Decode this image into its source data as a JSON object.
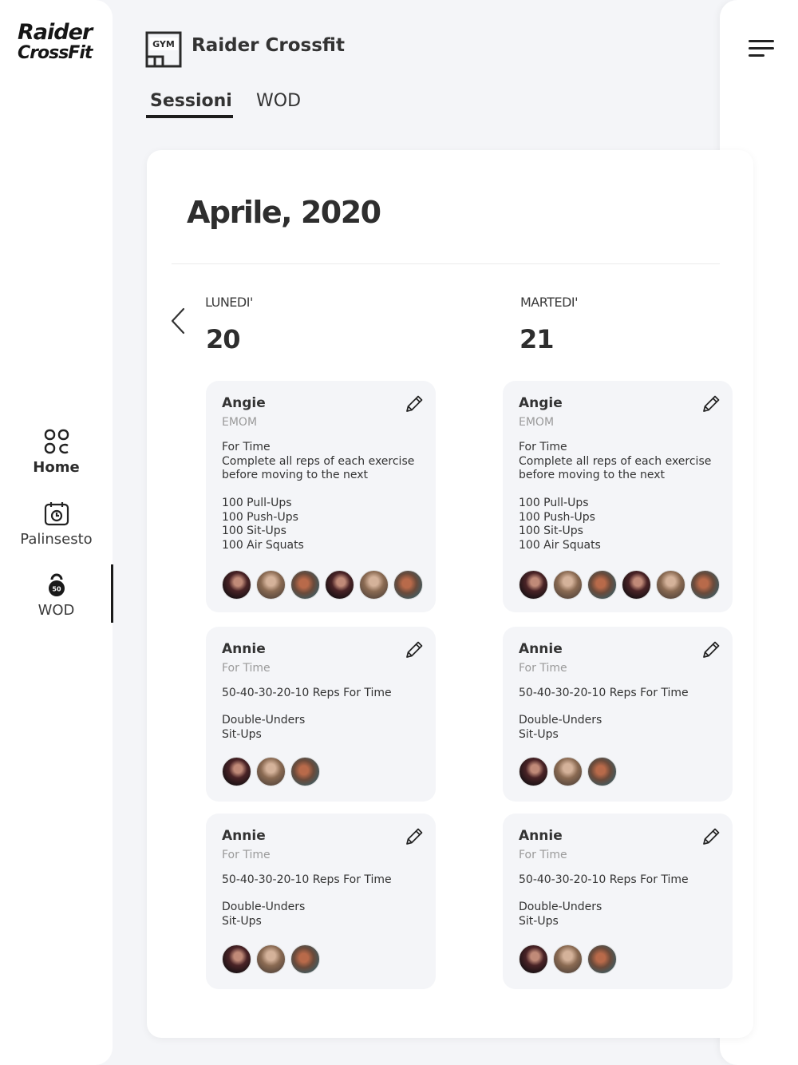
{
  "app": {
    "logo_line1": "Raider",
    "logo_line2": "CrossFit",
    "brand": "Raider Crossfit",
    "gym_icon_text": "GYM"
  },
  "nav": {
    "items": [
      {
        "label": "Home",
        "icon": "grid-icon"
      },
      {
        "label": "Palinsesto",
        "icon": "calendar-icon"
      },
      {
        "label": "WOD",
        "icon": "kettlebell-icon",
        "badge": "50"
      }
    ],
    "active": "WOD"
  },
  "tabs": [
    {
      "label": "Sessioni",
      "active": true
    },
    {
      "label": "WOD",
      "active": false
    }
  ],
  "month": "Aprile, 2020",
  "days": [
    {
      "name": "LUNEDI'",
      "number": "20",
      "cards": [
        {
          "title": "Angie",
          "type": "EMOM",
          "description": "For Time\nComplete all reps of each exercise\nbefore moving to the next",
          "exercises": "100 Pull-Ups\n100 Push-Ups\n100 Sit-Ups\n100 Air Squats",
          "avatars": [
            "a",
            "b",
            "c",
            "a",
            "b",
            "c"
          ]
        },
        {
          "title": "Annie",
          "type": "For Time",
          "description": "50-40-30-20-10 Reps For Time",
          "exercises": "Double-Unders\nSit-Ups",
          "avatars": [
            "a",
            "b",
            "c"
          ]
        },
        {
          "title": "Annie",
          "type": "For Time",
          "description": "50-40-30-20-10 Reps For Time",
          "exercises": "Double-Unders\nSit-Ups",
          "avatars": [
            "a",
            "b",
            "c"
          ]
        }
      ]
    },
    {
      "name": "MARTEDI'",
      "number": "21",
      "cards": [
        {
          "title": "Angie",
          "type": "EMOM",
          "description": "For Time\nComplete all reps of each exercise\nbefore moving to the next",
          "exercises": "100 Pull-Ups\n100 Push-Ups\n100 Sit-Ups\n100 Air Squats",
          "avatars": [
            "a",
            "b",
            "c",
            "a",
            "b",
            "c"
          ]
        },
        {
          "title": "Annie",
          "type": "For Time",
          "description": "50-40-30-20-10 Reps For Time",
          "exercises": "Double-Unders\nSit-Ups",
          "avatars": [
            "a",
            "b",
            "c"
          ]
        },
        {
          "title": "Annie",
          "type": "For Time",
          "description": "50-40-30-20-10 Reps For Time",
          "exercises": "Double-Unders\nSit-Ups",
          "avatars": [
            "a",
            "b",
            "c"
          ]
        }
      ]
    }
  ]
}
